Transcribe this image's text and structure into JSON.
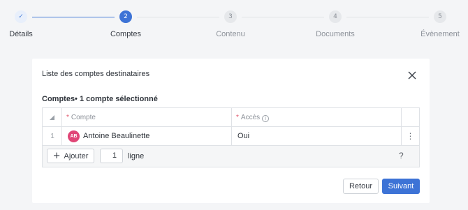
{
  "stepper": {
    "steps": [
      {
        "number": "✓",
        "label": "Détails",
        "state": "done"
      },
      {
        "number": "2",
        "label": "Comptes",
        "state": "active"
      },
      {
        "number": "3",
        "label": "Contenu",
        "state": "todo"
      },
      {
        "number": "4",
        "label": "Documents",
        "state": "todo"
      },
      {
        "number": "5",
        "label": "Évènement",
        "state": "todo"
      }
    ]
  },
  "card": {
    "title": "Liste des comptes destinataires",
    "close_icon": "close-icon",
    "section_title": "Comptes• 1 compte sélectionné"
  },
  "table": {
    "columns": [
      {
        "required": "*",
        "label": "Compte"
      },
      {
        "required": "*",
        "label": "Accès",
        "info": "i"
      }
    ],
    "rows": [
      {
        "index": "1",
        "avatar": "AB",
        "avatar_color": "#e04677",
        "account": "Antoine Beaulinette",
        "access": "Oui",
        "menu": "⋮"
      }
    ],
    "footer": {
      "add_label": "Ajouter",
      "add_icon": "plus-icon",
      "quantity": "1",
      "unit_label": "ligne",
      "help": "?"
    }
  },
  "actions": {
    "back_label": "Retour",
    "next_label": "Suivant"
  },
  "colors": {
    "primary": "#3d73d6",
    "avatar": "#e04677",
    "required": "#e0556a"
  }
}
